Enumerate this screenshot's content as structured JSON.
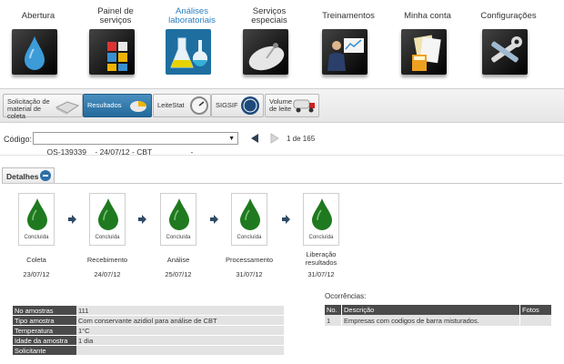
{
  "nav": [
    {
      "label": "Abertura",
      "icon": "water-drop-icon",
      "active": false
    },
    {
      "label": "Painel de serviços",
      "icon": "dashboard-grid-icon",
      "active": false
    },
    {
      "label": "Análises laboratoriais",
      "icon": "lab-flask-icon",
      "active": true
    },
    {
      "label": "Serviços especiais",
      "icon": "satellite-dish-icon",
      "active": false
    },
    {
      "label": "Treinamentos",
      "icon": "presenter-icon",
      "active": false
    },
    {
      "label": "Minha conta",
      "icon": "documents-calculator-icon",
      "active": false
    },
    {
      "label": "Configurações",
      "icon": "tools-icon",
      "active": false
    }
  ],
  "subtabs": [
    {
      "label": "Solicitação de material de coleta",
      "active": false
    },
    {
      "label": "Resultados",
      "active": true
    },
    {
      "label": "LeiteStat",
      "active": false
    },
    {
      "label": "SIGSIF",
      "active": false
    },
    {
      "label": "Volume de leite",
      "active": false
    }
  ],
  "code": {
    "label": "Código:",
    "value": "OS-139339    - 24/07/12 - CBT                  -",
    "pager": "1 de 165"
  },
  "details": {
    "title": "Detalhes"
  },
  "stages": [
    {
      "name": "Coleta",
      "date": "23/07/12",
      "status": "Concluída"
    },
    {
      "name": "Recebimento",
      "date": "24/07/12",
      "status": "Concluída"
    },
    {
      "name": "Análise",
      "date": "25/07/12",
      "status": "Concluída"
    },
    {
      "name": "Processamento",
      "date": "31/07/12",
      "status": "Concluída"
    },
    {
      "name": "Liberação resultados",
      "date": "31/07/12",
      "status": "Concluída"
    }
  ],
  "info": [
    {
      "key": "No amostras",
      "value": "111"
    },
    {
      "key": "Tipo amostra",
      "value": "Com conservante azidiol para análise de CBT"
    },
    {
      "key": "Temperatura",
      "value": "1°C"
    },
    {
      "key": "Idade da amostra",
      "value": "1 dia"
    },
    {
      "key": "Solicitante",
      "value": ""
    }
  ],
  "occurrences": {
    "title": "Ocorrências:",
    "headers": [
      "No.",
      "Descrição",
      "Fotos"
    ],
    "rows": [
      {
        "no": "1",
        "desc": "Empresas com codigos de barra misturados.",
        "photos": ""
      }
    ]
  },
  "colors": {
    "accent": "#2a7fc0",
    "drop": "#1f7a1f",
    "header_dark": "#4a4a4a"
  }
}
